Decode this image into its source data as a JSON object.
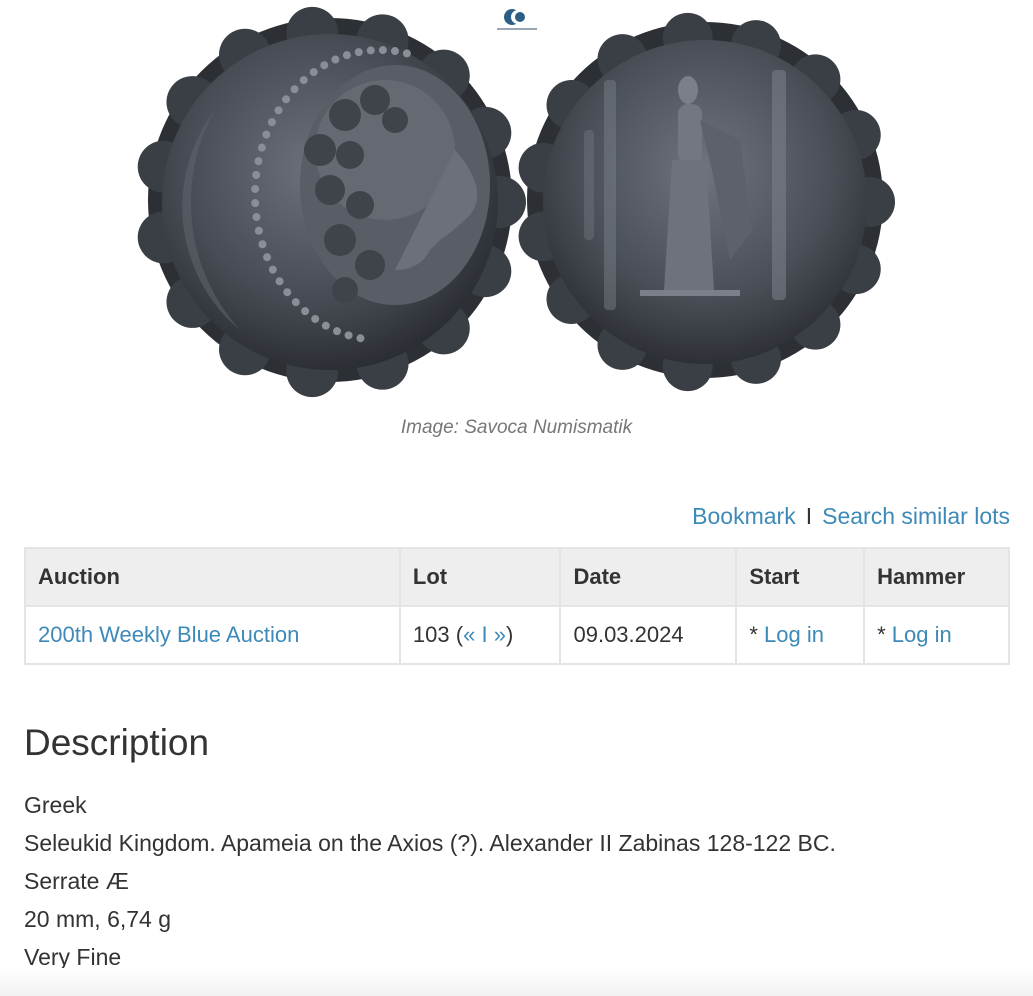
{
  "image": {
    "caption": "Image: Savoca Numismatik",
    "watermark_icon": "savoca-logo-icon",
    "obverse_alt": "coin-obverse",
    "reverse_alt": "coin-reverse"
  },
  "actions": {
    "bookmark_label": "Bookmark",
    "separator": "I",
    "search_similar_label": "Search similar lots"
  },
  "table": {
    "headers": {
      "auction": "Auction",
      "lot": "Lot",
      "date": "Date",
      "start": "Start",
      "hammer": "Hammer"
    },
    "row": {
      "auction": "200th Weekly Blue Auction",
      "lot_number": "103",
      "lot_open": "(",
      "lot_prev": "«",
      "lot_sep": "I",
      "lot_next": "»",
      "lot_close": ")",
      "date": "09.03.2024",
      "start_prefix": "*",
      "start_link": "Log in",
      "hammer_prefix": "*",
      "hammer_link": "Log in"
    }
  },
  "description": {
    "heading": "Description",
    "lines": [
      "Greek",
      "Seleukid Kingdom. Apameia on the Axios (?). Alexander II Zabinas 128-122 BC.",
      "Serrate Æ",
      "20 mm, 6,74 g",
      "Very Fine"
    ]
  },
  "colors": {
    "link": "#3d8ab8",
    "text": "#333333",
    "header_bg": "#eeeeee",
    "border": "#e4e4e4",
    "coin_dark": "#2e3238",
    "coin_mid": "#555a63"
  }
}
